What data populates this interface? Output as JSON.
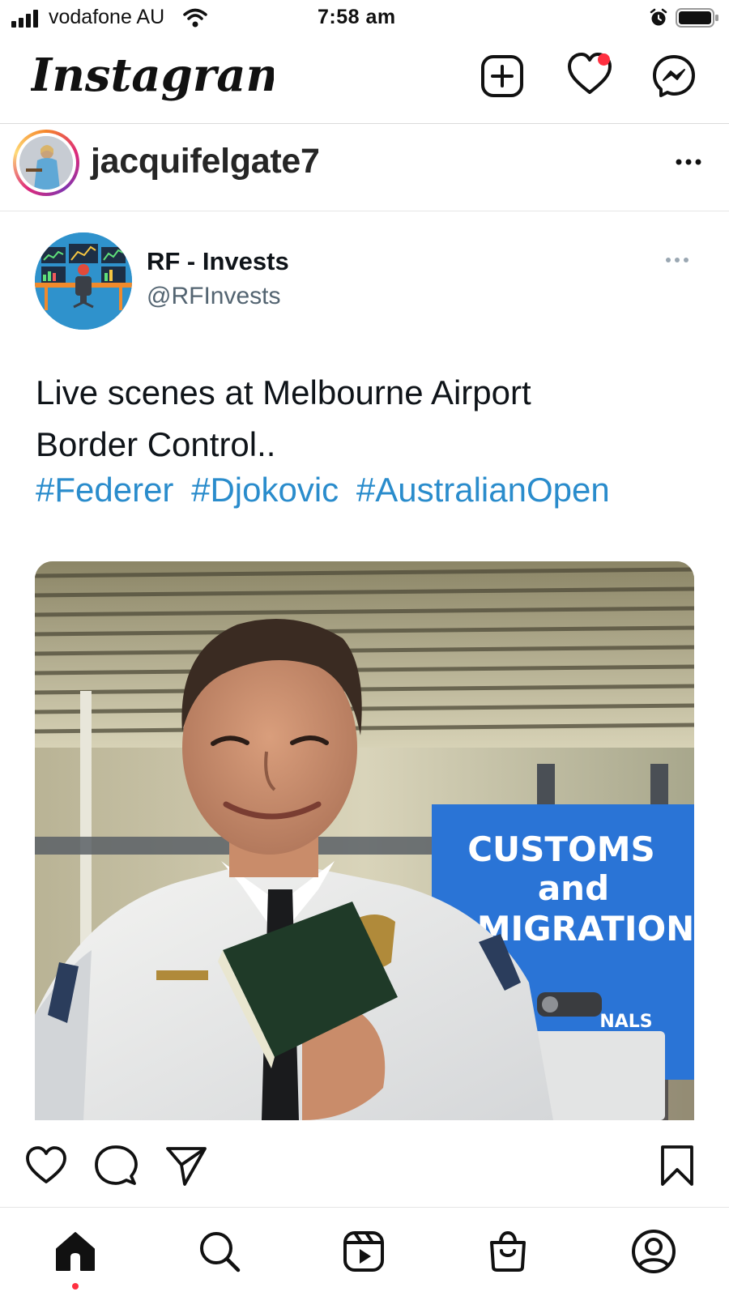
{
  "status_bar": {
    "carrier": "vodafone AU",
    "time": "7:58 am",
    "signal_bars": 4,
    "battery_level": 1.0
  },
  "app": {
    "name": "Instagram",
    "icons": [
      "new-post-icon",
      "activity-heart-icon",
      "messenger-icon"
    ],
    "activity_has_notification": true
  },
  "post": {
    "username": "jacquifelgate7",
    "more_icon": "ellipsis-icon"
  },
  "tweet": {
    "display_name": "RF - Invests",
    "handle": "@RFInvests",
    "text_line1": "Live scenes at Melbourne Airport",
    "text_line2": "Border Control..",
    "hashtags": [
      "#Federer",
      "#Djokovic",
      "#AustralianOpen"
    ],
    "image": {
      "sign_line1": "CUSTOMS",
      "sign_line2": "and",
      "sign_line3": "MIGRATION",
      "sign_partial": "NALS"
    }
  },
  "actions": {
    "icons": [
      "heart-icon",
      "comment-icon",
      "share-icon",
      "bookmark-icon"
    ]
  },
  "bottom_nav": {
    "items": [
      "home-icon",
      "search-icon",
      "reels-icon",
      "shop-icon",
      "profile-icon"
    ],
    "active": "home-icon"
  },
  "colors": {
    "hashtag": "#2a8ccc",
    "notification": "#ff3040",
    "handle": "#536471",
    "sign_blue": "#2a74d6"
  }
}
